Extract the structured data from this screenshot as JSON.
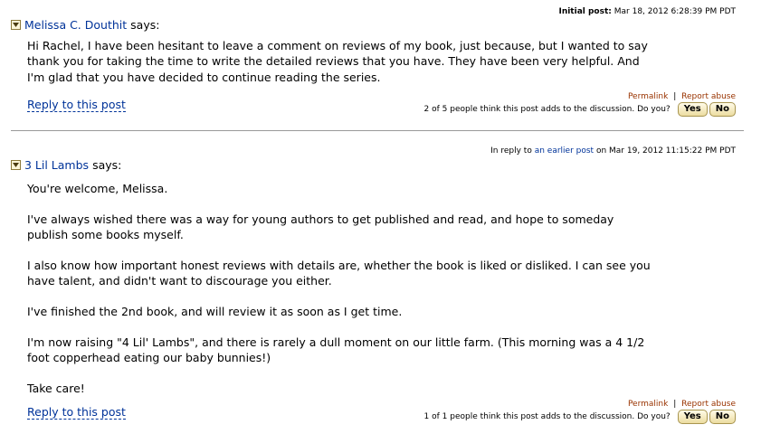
{
  "posts": [
    {
      "author": "Melissa C. Douthit",
      "says": "says:",
      "meta_label": "Initial post:",
      "meta_date": "Mar 18, 2012 6:28:39 PM PDT",
      "body": [
        "Hi Rachel, I have been hesitant to leave a comment on reviews of my book, just because, but I wanted to say",
        "thank you for taking the time to write the detailed reviews that you have. They have been very helpful. And",
        "I'm glad that you have decided to continue reading the series."
      ],
      "reply_label": "Reply to this post",
      "permalink": "Permalink",
      "separator": "|",
      "report": "Report abuse",
      "vote_text": "2 of 5 people think this post adds to the discussion. Do you?",
      "yes": "Yes",
      "no": "No"
    },
    {
      "author": "3 Lil Lambs",
      "says": "says:",
      "meta_prefix": "In reply to",
      "meta_link": "an earlier post",
      "meta_suffix": "on Mar 19, 2012 11:15:22 PM PDT",
      "paragraphs": [
        [
          "You're welcome, Melissa."
        ],
        [
          "I've always wished there was a way for young authors to get published and read, and hope to someday",
          "publish some books myself."
        ],
        [
          "I also know how important honest reviews with details are, whether the book is liked or disliked. I can see you",
          "have talent, and didn't want to discourage you either."
        ],
        [
          "I've finished the 2nd book, and will review it as soon as I get time."
        ],
        [
          "I'm now raising \"4 Lil' Lambs\", and there is rarely a dull moment on our little farm. (This morning was a 4 1/2",
          "foot copperhead eating our baby bunnies!)"
        ],
        [
          "Take care!"
        ]
      ],
      "reply_label": "Reply to this post",
      "permalink": "Permalink",
      "separator": "|",
      "report": "Report abuse",
      "vote_text": "1 of 1 people think this post adds to the discussion. Do you?",
      "yes": "Yes",
      "no": "No"
    }
  ]
}
